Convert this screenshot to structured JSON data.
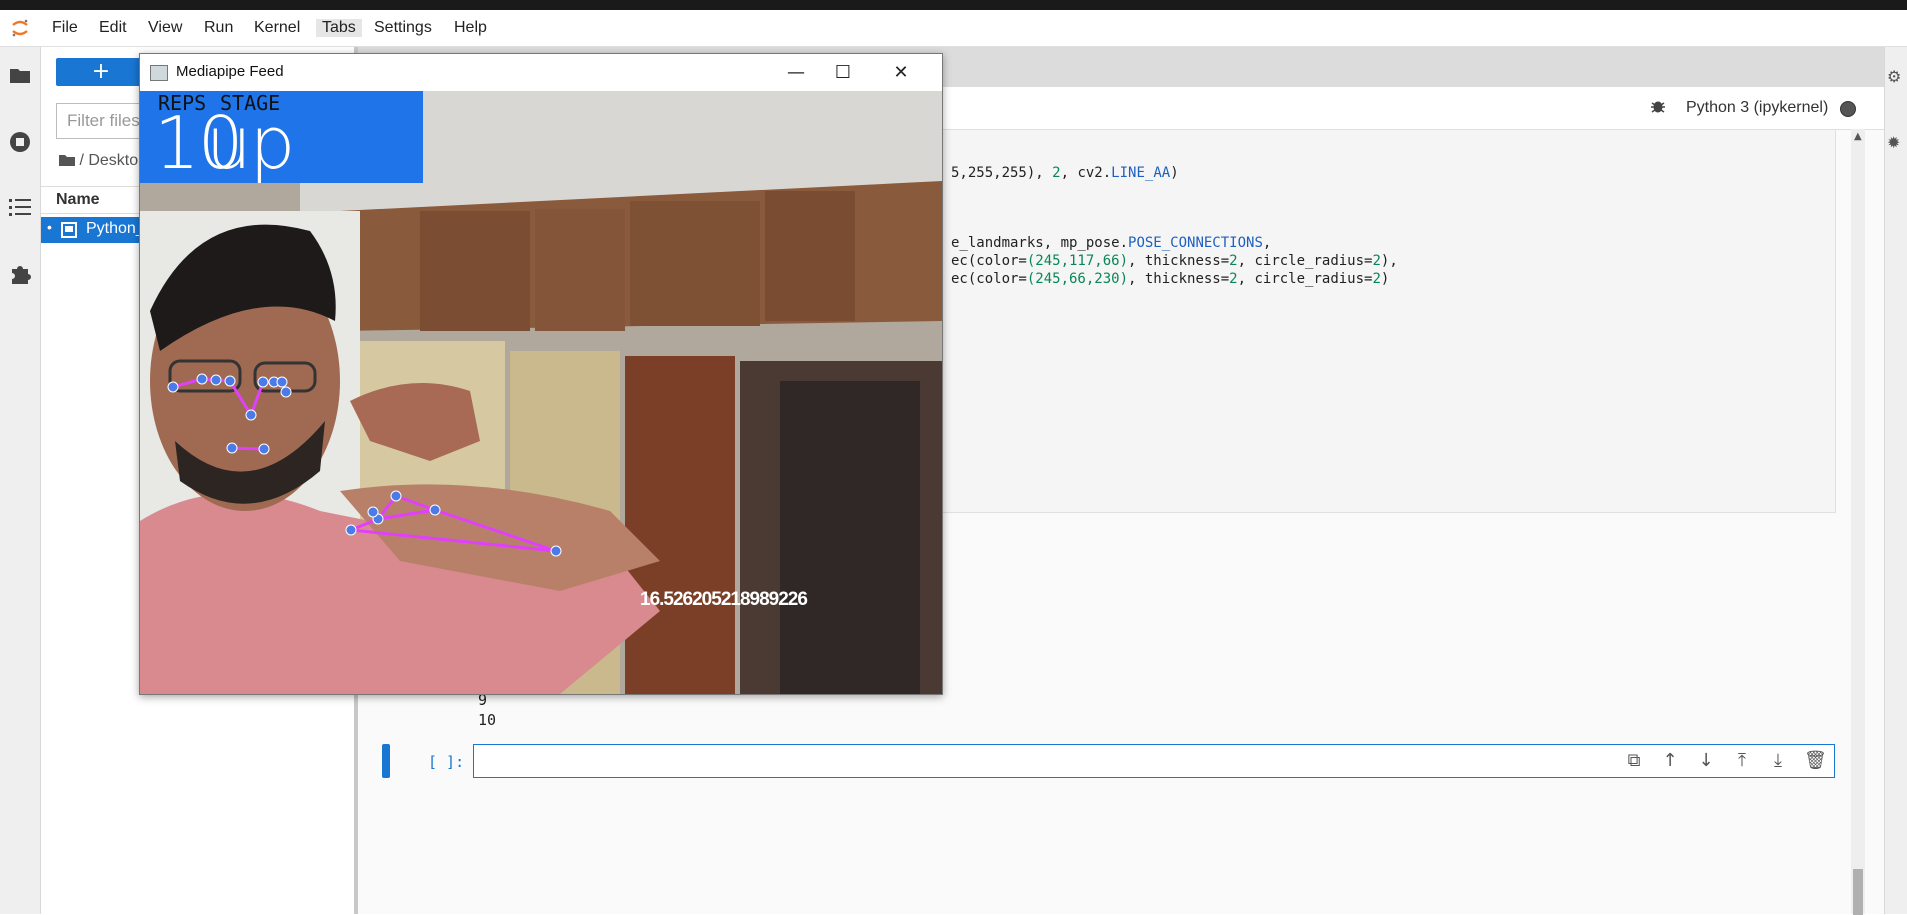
{
  "menubar": {
    "items": [
      "File",
      "Edit",
      "View",
      "Run",
      "Kernel",
      "Tabs",
      "Settings",
      "Help"
    ]
  },
  "filebrowser": {
    "new_button": "+",
    "filter_placeholder": "Filter files",
    "breadcrumb": "/ Deskto",
    "column_name": "Name",
    "file_name": "Python_"
  },
  "notebook": {
    "kernel_name": "Python 3 (ipykernel)",
    "code_lines": [
      {
        "segments": [
          [
            "",
            "5,255,255), "
          ],
          [
            "num",
            "2"
          ],
          [
            "",
            ", cv2."
          ],
          [
            "kw",
            "LINE_AA"
          ],
          [
            "",
            ")"
          ]
        ]
      },
      {
        "segments": [
          [
            "",
            "e_landmarks, mp_pose."
          ],
          [
            "kw",
            "POSE_CONNECTIONS"
          ],
          [
            "",
            ","
          ]
        ]
      },
      {
        "segments": [
          [
            "",
            "ec(color="
          ],
          [
            "num",
            "(245,117,66)"
          ],
          [
            "",
            ", thickness="
          ],
          [
            "num",
            "2"
          ],
          [
            "",
            ", circle_radius="
          ],
          [
            "num",
            "2"
          ],
          [
            "",
            "),"
          ]
        ]
      },
      {
        "segments": [
          [
            "",
            "ec(color="
          ],
          [
            "num",
            "(245,66,230)"
          ],
          [
            "",
            ", thickness="
          ],
          [
            "num",
            "2"
          ],
          [
            "",
            ", circle_radius="
          ],
          [
            "num",
            "2"
          ],
          [
            "",
            ")"
          ]
        ]
      }
    ],
    "output_lines": [
      "9",
      "10"
    ],
    "cell_prompt": "[ ]:"
  },
  "window": {
    "title": "Mediapipe Feed",
    "minimize": "—",
    "maximize": "☐",
    "close": "✕"
  },
  "feed": {
    "label_reps": "REPS",
    "label_stage": "STAGE",
    "reps_value": "10",
    "stage_value": "up",
    "angle_value": "16.526205218989226"
  },
  "colors": {
    "accent": "#1976d2",
    "overlay_box": "#1e74e8",
    "landmark": "#4a7be8",
    "connection": "#e040fb"
  }
}
